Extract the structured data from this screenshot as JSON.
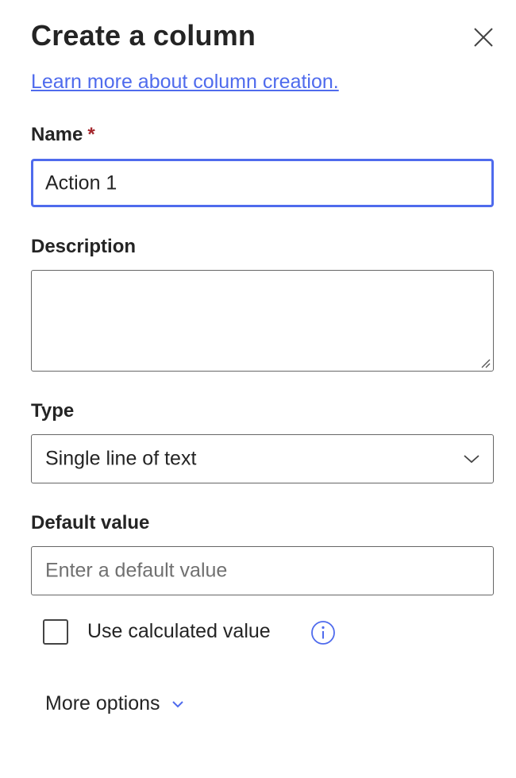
{
  "panel": {
    "title": "Create a column",
    "learn_more_link": "Learn more about column creation.",
    "close_icon": "close-icon"
  },
  "name": {
    "label": "Name",
    "required_marker": "*",
    "value": "Action 1"
  },
  "description": {
    "label": "Description",
    "value": ""
  },
  "type": {
    "label": "Type",
    "selected": "Single line of text",
    "icon": "chevron-down-icon"
  },
  "default_value": {
    "label": "Default value",
    "placeholder": "Enter a default value",
    "value": ""
  },
  "calculated": {
    "label": "Use calculated value",
    "checked": false,
    "info_icon": "info-icon"
  },
  "more_options": {
    "label": "More options",
    "icon": "chevron-down-icon"
  },
  "colors": {
    "accent": "#4f6bed",
    "required": "#a4262c",
    "text": "#242424",
    "placeholder": "#707070",
    "border": "#666666"
  }
}
